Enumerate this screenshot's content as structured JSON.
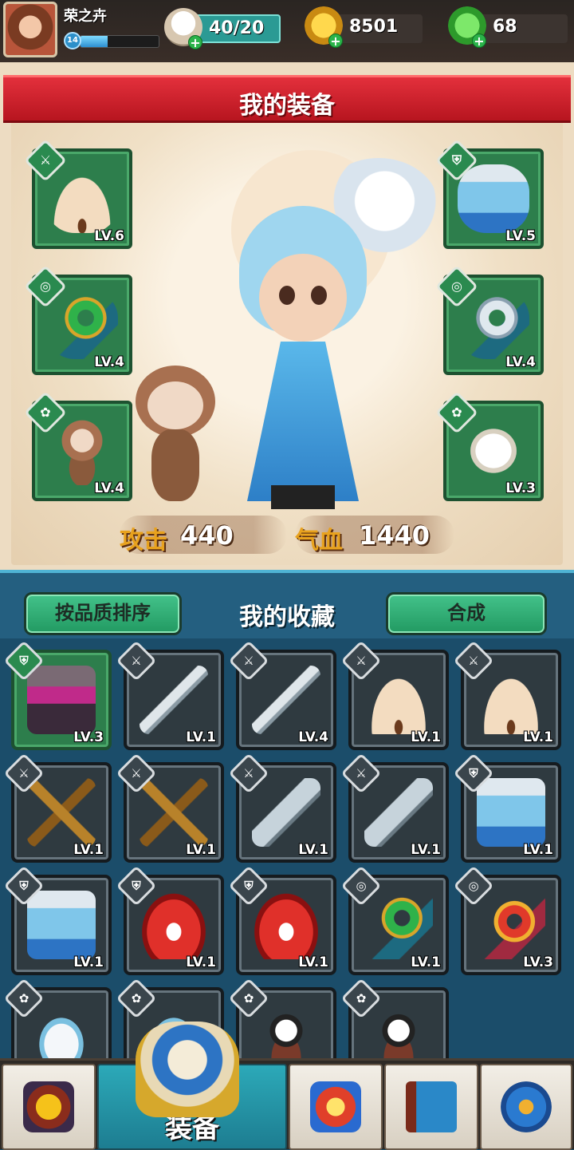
{
  "player": {
    "name": "荣之卉",
    "level": "14",
    "xp_fraction": 0.35
  },
  "resources": {
    "stamina": "40/20",
    "gold": "8501",
    "jade": "68"
  },
  "equip_panel": {
    "title": "我的装备",
    "left_slots": [
      {
        "badge": "weapon-badge-icon",
        "item": "fan-icon",
        "level": "LV.6"
      },
      {
        "badge": "accessory-badge-icon",
        "item": "jade-pendant-icon",
        "level": "LV.4"
      },
      {
        "badge": "pet-badge-icon",
        "item": "monkey-pet-icon",
        "level": "LV.4"
      }
    ],
    "right_slots": [
      {
        "badge": "armor-badge-icon",
        "item": "blue-robe-icon",
        "level": "LV.5"
      },
      {
        "badge": "accessory-badge-icon",
        "item": "silver-pendant-icon",
        "level": "LV.4"
      },
      {
        "badge": "pet-badge-icon",
        "item": "owl-pet-icon",
        "level": "LV.3"
      }
    ],
    "stats": {
      "attack_label": "攻击",
      "attack": "440",
      "hp_label": "气血",
      "hp": "1440"
    }
  },
  "collection": {
    "sort_button": "按品质排序",
    "title": "我的收藏",
    "combine_button": "合成",
    "items": [
      {
        "item": "purple-robe-icon",
        "level": "LV.3",
        "selected": true
      },
      {
        "item": "sword-icon",
        "level": "LV.1"
      },
      {
        "item": "sword-icon",
        "level": "LV.4"
      },
      {
        "item": "fan-icon",
        "level": "LV.1"
      },
      {
        "item": "fan-icon",
        "level": "LV.1"
      },
      {
        "item": "crossbow-icon",
        "level": "LV.1"
      },
      {
        "item": "crossbow-icon",
        "level": "LV.1"
      },
      {
        "item": "dagger-icon",
        "level": "LV.1"
      },
      {
        "item": "dagger-icon",
        "level": "LV.1"
      },
      {
        "item": "blue-robe-icon",
        "level": "LV.1"
      },
      {
        "item": "blue-robe-icon",
        "level": "LV.1"
      },
      {
        "item": "red-robe-icon",
        "level": "LV.1"
      },
      {
        "item": "red-robe-icon",
        "level": "LV.1"
      },
      {
        "item": "jade-pendant-icon",
        "level": "LV.1"
      },
      {
        "item": "phoenix-pendant-icon",
        "level": "LV.3"
      },
      {
        "item": "ferret-pet-icon",
        "level": ""
      },
      {
        "item": "ferret-pet-icon",
        "level": ""
      },
      {
        "item": "panda-pet-icon",
        "level": ""
      },
      {
        "item": "panda-pet-icon",
        "level": ""
      }
    ]
  },
  "tabs": [
    {
      "icon": "shop-icon",
      "label": ""
    },
    {
      "icon": "equipment-icon",
      "label": "装备"
    },
    {
      "icon": "adventure-icon",
      "label": ""
    },
    {
      "icon": "book-icon",
      "label": ""
    },
    {
      "icon": "settings-gear-icon",
      "label": ""
    }
  ],
  "colors": {
    "ribbon": "#d8222e",
    "slot_green": "#2d7e4c",
    "button_green": "#34b176",
    "lower_bg": "#1f5574"
  }
}
